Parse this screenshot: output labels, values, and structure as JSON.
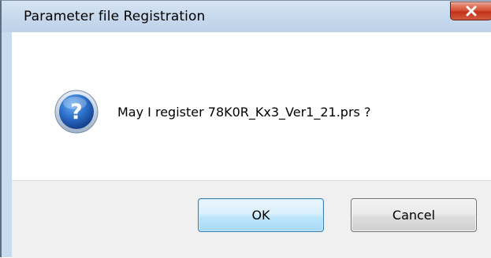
{
  "window": {
    "title": "Parameter file Registration",
    "close_icon": "close-icon"
  },
  "message": {
    "icon": "question-icon",
    "text": "May I register 78K0R_Kx3_Ver1_21.prs ?"
  },
  "buttons": {
    "ok_label": "OK",
    "cancel_label": "Cancel"
  },
  "colors": {
    "title_bar": "#c6d8ec",
    "close_button": "#c2331b",
    "content_bg": "#ffffff",
    "footer_bg": "#f0f0f0",
    "ok_button_border": "#3c7fb1",
    "question_icon": "#1f5fb8"
  }
}
